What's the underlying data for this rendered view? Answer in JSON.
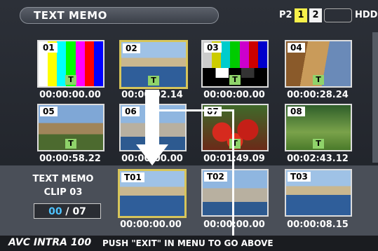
{
  "header": {
    "title": "TEXT MEMO",
    "p2_label": "P2",
    "slot1": "1",
    "slot2": "2",
    "hdd_label": "HDD"
  },
  "clips": [
    {
      "num": "01",
      "timecode": "00:00:00.00",
      "scene": "colorbars"
    },
    {
      "num": "02",
      "timecode": "00:00:02.14",
      "scene": "harbor"
    },
    {
      "num": "03",
      "timecode": "00:00:00.00",
      "scene": "colorbars2"
    },
    {
      "num": "04",
      "timecode": "00:00:28.24",
      "scene": "street"
    },
    {
      "num": "05",
      "timecode": "00:00:58.22",
      "scene": "castle"
    },
    {
      "num": "06",
      "timecode": "00:00:00.00",
      "scene": "city"
    },
    {
      "num": "07",
      "timecode": "00:01:49.09",
      "scene": "tomatoes"
    },
    {
      "num": "08",
      "timecode": "00:02:43.12",
      "scene": "forest"
    }
  ],
  "memos": [
    {
      "num": "T01",
      "timecode": "00:00:00.00"
    },
    {
      "num": "T02",
      "timecode": "00:00:00.00"
    },
    {
      "num": "T03",
      "timecode": "00:00:08.15"
    }
  ],
  "memo_mark": "T",
  "panel": {
    "title": "TEXT MEMO",
    "clip": "CLIP 03",
    "current": "00",
    "separator": " / ",
    "total": "07"
  },
  "footer": {
    "logo": "AVC INTRA 100",
    "message": "PUSH \"EXIT\" IN MENU TO GO ABOVE"
  },
  "colors": {
    "selected_border": "#d7c55a",
    "memo_mark": "#8fd36a",
    "counter_current": "#4ec3ff",
    "slot1": "#f7f04a"
  }
}
